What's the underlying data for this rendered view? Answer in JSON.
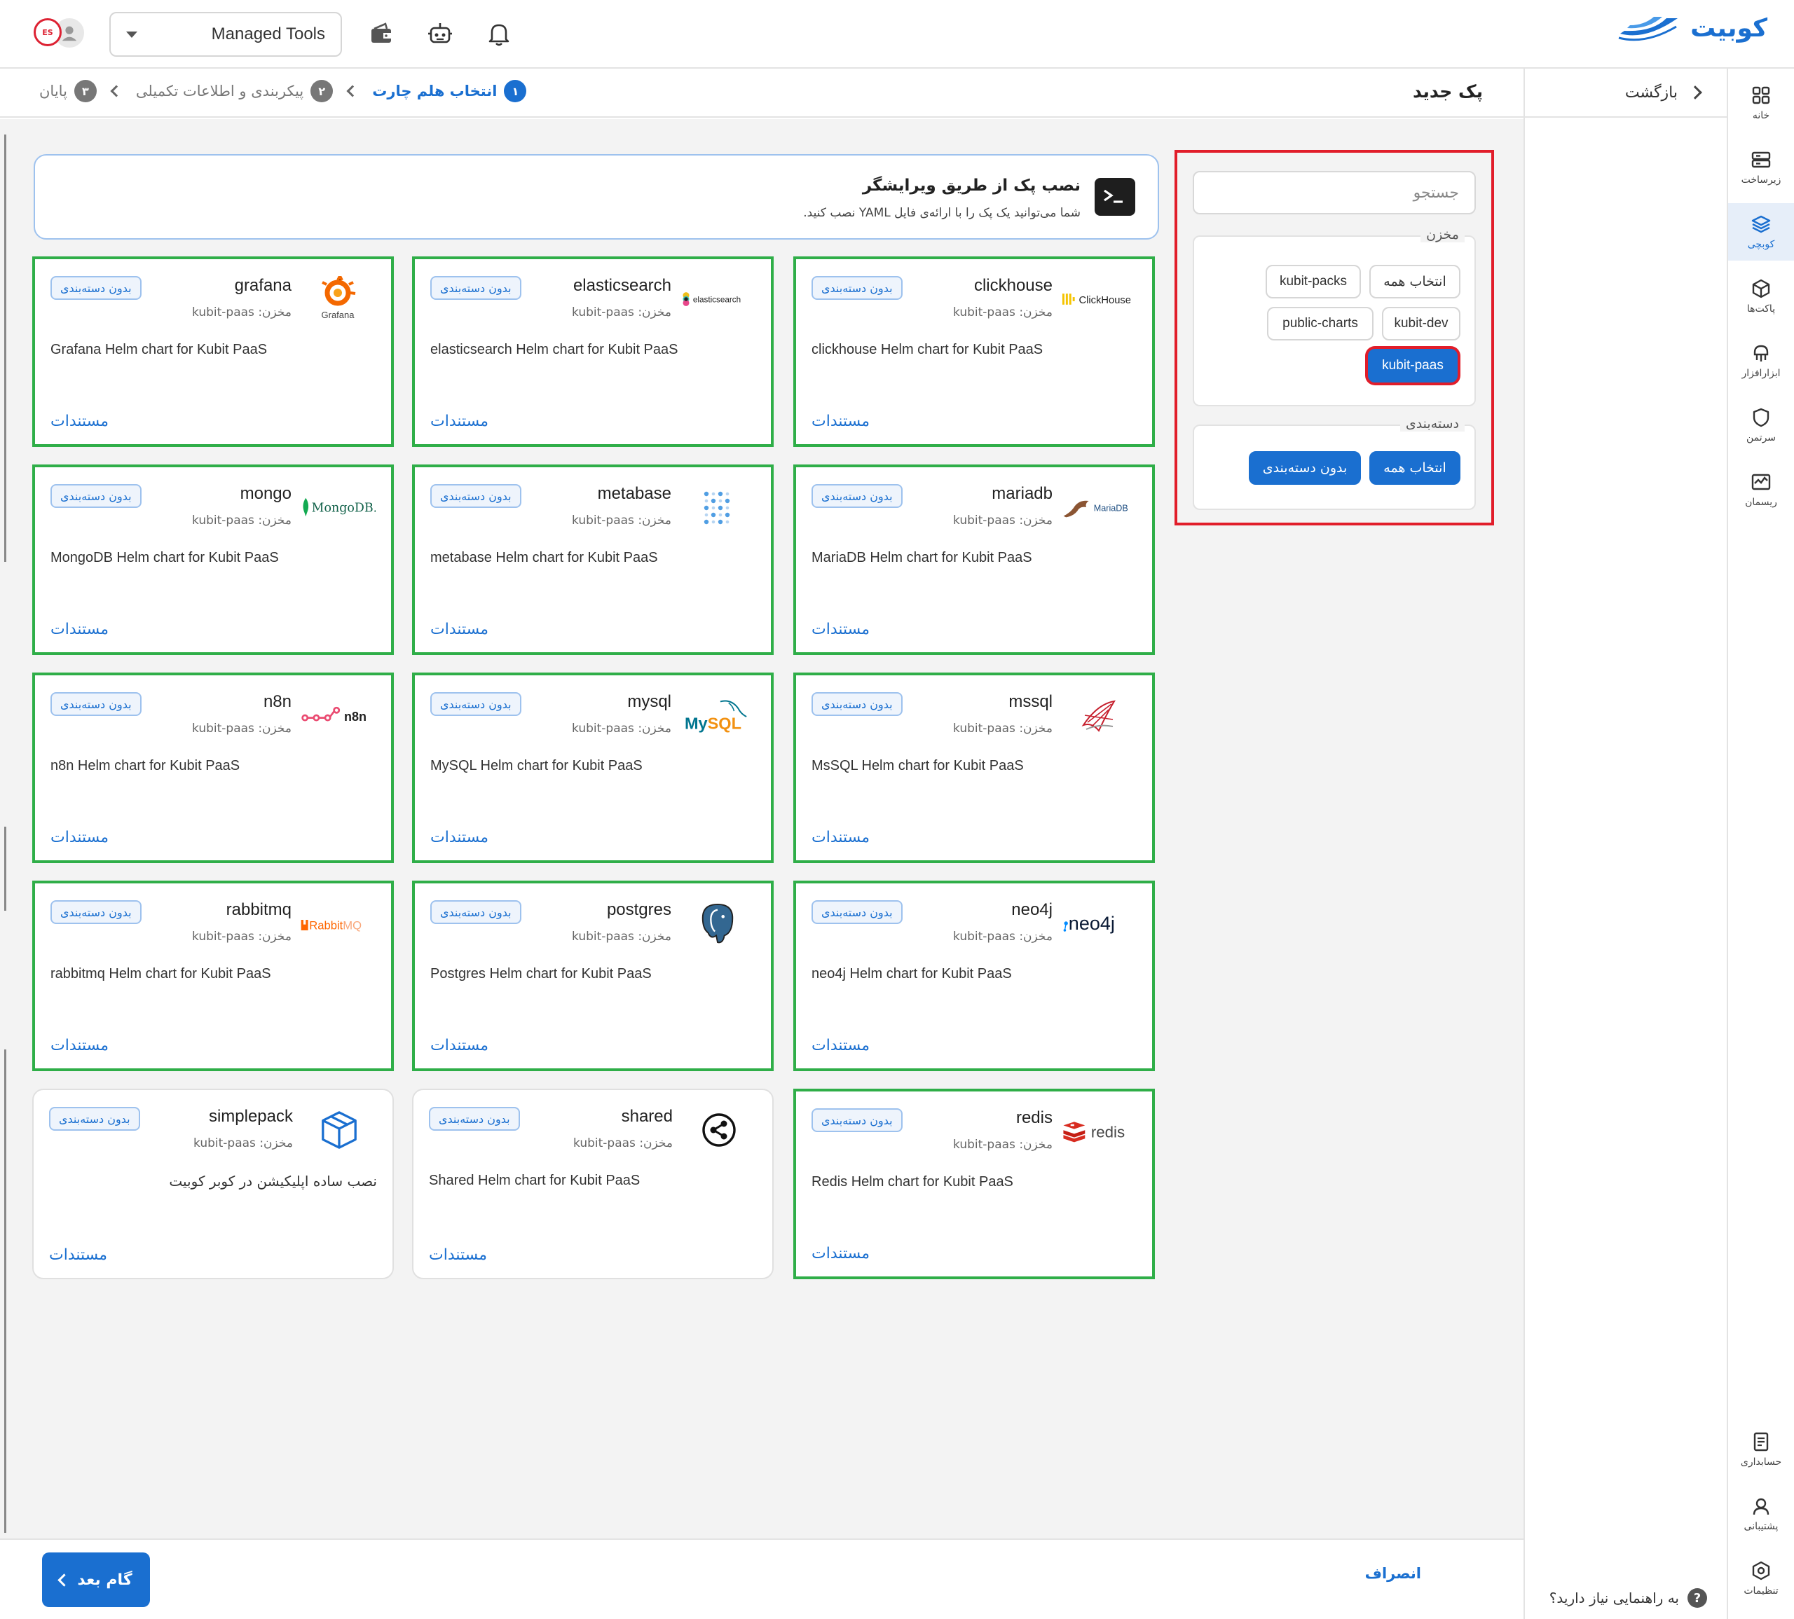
{
  "brand": {
    "name": "کوبیت",
    "color": "#1a6fd0"
  },
  "header": {
    "tool_selector": "Managed Tools",
    "icons": [
      "wallet-icon",
      "robot-icon",
      "bell-icon"
    ],
    "avatar_badge": "ES"
  },
  "nav": [
    {
      "id": "home",
      "label": "خانه",
      "icon": "grid-icon",
      "active": false
    },
    {
      "id": "infra",
      "label": "زیرساخت",
      "icon": "server-icon",
      "active": false
    },
    {
      "id": "kubi",
      "label": "کوبچی",
      "icon": "layers-icon",
      "active": true
    },
    {
      "id": "packets",
      "label": "پاکت‌ها",
      "icon": "cube-icon",
      "active": false
    },
    {
      "id": "tools",
      "label": "ابزارافزار",
      "icon": "tool-icon",
      "active": false
    },
    {
      "id": "guard",
      "label": "سرتمن",
      "icon": "shield-icon",
      "active": false
    },
    {
      "id": "monitor",
      "label": "ریسمان",
      "icon": "chart-icon",
      "active": false
    }
  ],
  "nav_bottom": [
    {
      "id": "billing",
      "label": "حسابداری",
      "icon": "receipt-icon"
    },
    {
      "id": "support",
      "label": "پشتیبانی",
      "icon": "headset-icon"
    },
    {
      "id": "settings",
      "label": "تنظیمات",
      "icon": "hexagon-gear-icon"
    }
  ],
  "subcol": {
    "back": "بازگشت",
    "help": "به راهنمایی نیاز دارید؟",
    "help_icon": "?"
  },
  "page": {
    "title": "پک جدید"
  },
  "steps": [
    {
      "num": "۱",
      "label": "انتخاب هلم چارت",
      "active": true
    },
    {
      "num": "۲",
      "label": "پیکربندی و اطلاعات تکمیلی",
      "active": false
    },
    {
      "num": "۳",
      "label": "پایان",
      "active": false
    }
  ],
  "editor_banner": {
    "title": "نصب پک از طریق ویرایشگر",
    "subtitle": "شما می‌توانید یک پک را با ارائه‌ی فایل YAML نصب کنید."
  },
  "filters": {
    "search_placeholder": "جستجو",
    "repo_label": "مخزن",
    "repo_chips": [
      "انتخاب همه",
      "kubit-packs",
      "kubit-dev",
      "public-charts",
      "kubit-paas"
    ],
    "repo_selected": "kubit-paas",
    "category_label": "دسته‌بندی",
    "category_chips": [
      "انتخاب همه",
      "بدون دسته‌بندی"
    ]
  },
  "card_common": {
    "badge": "بدون دسته‌بندی",
    "repo_prefix": "مخزن: ",
    "docs": "مستندات"
  },
  "cards": [
    {
      "name": "clickhouse",
      "repo": "kubit-paas",
      "desc": "clickhouse Helm chart for Kubit PaaS",
      "logo": "clickhouse-logo",
      "logo_text": "ClickHouse"
    },
    {
      "name": "elasticsearch",
      "repo": "kubit-paas",
      "desc": "elasticsearch Helm chart for Kubit PaaS",
      "logo": "elasticsearch-logo",
      "logo_text": "elasticsearch"
    },
    {
      "name": "grafana",
      "repo": "kubit-paas",
      "desc": "Grafana Helm chart for Kubit PaaS",
      "logo": "grafana-logo",
      "logo_text": "Grafana"
    },
    {
      "name": "mariadb",
      "repo": "kubit-paas",
      "desc": "MariaDB Helm chart for Kubit PaaS",
      "logo": "mariadb-logo",
      "logo_text": "MariaDB"
    },
    {
      "name": "metabase",
      "repo": "kubit-paas",
      "desc": "metabase Helm chart for Kubit PaaS",
      "logo": "metabase-logo",
      "logo_text": ""
    },
    {
      "name": "mongo",
      "repo": "kubit-paas",
      "desc": "MongoDB Helm chart for Kubit PaaS",
      "logo": "mongodb-logo",
      "logo_text": "MongoDB."
    },
    {
      "name": "mssql",
      "repo": "kubit-paas",
      "desc": "MsSQL Helm chart for Kubit PaaS",
      "logo": "mssql-logo",
      "logo_text": ""
    },
    {
      "name": "mysql",
      "repo": "kubit-paas",
      "desc": "MySQL Helm chart for Kubit PaaS",
      "logo": "mysql-logo",
      "logo_text": "MySQL"
    },
    {
      "name": "n8n",
      "repo": "kubit-paas",
      "desc": "n8n Helm chart for Kubit PaaS",
      "logo": "n8n-logo",
      "logo_text": "n8n"
    },
    {
      "name": "neo4j",
      "repo": "kubit-paas",
      "desc": "neo4j Helm chart for Kubit PaaS",
      "logo": "neo4j-logo",
      "logo_text": "neo4j"
    },
    {
      "name": "postgres",
      "repo": "kubit-paas",
      "desc": "Postgres Helm chart for Kubit PaaS",
      "logo": "postgres-logo",
      "logo_text": ""
    },
    {
      "name": "rabbitmq",
      "repo": "kubit-paas",
      "desc": "rabbitmq Helm chart for Kubit PaaS",
      "logo": "rabbitmq-logo",
      "logo_text": "RabbitMQ"
    },
    {
      "name": "redis",
      "repo": "kubit-paas",
      "desc": "Redis Helm chart for Kubit PaaS",
      "logo": "redis-logo",
      "logo_text": "redis"
    },
    {
      "name": "shared",
      "repo": "kubit-paas",
      "desc": "Shared Helm chart for Kubit PaaS",
      "logo": "share-logo",
      "logo_text": ""
    },
    {
      "name": "simplepack",
      "repo": "kubit-paas",
      "desc": "نصب ساده اپلیکیشن در کوبر کوبیت",
      "logo": "box-logo",
      "logo_text": ""
    }
  ],
  "footer": {
    "next": "گام بعد",
    "cancel": "انصراف"
  },
  "colors": {
    "accent": "#1a6fd0",
    "highlight_green": "#2fae48",
    "highlight_red": "#e11d2a"
  }
}
